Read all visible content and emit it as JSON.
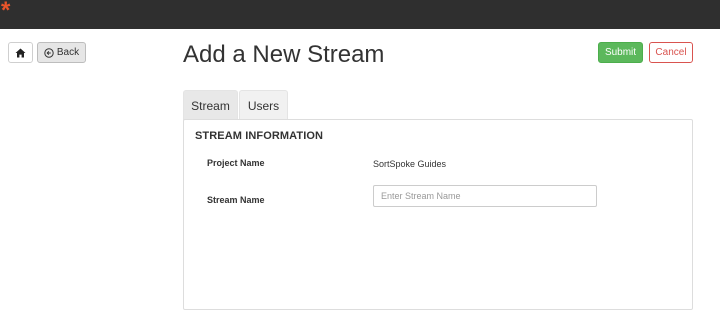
{
  "header": {
    "logo": "*"
  },
  "nav": {
    "back_label": "Back"
  },
  "page": {
    "title": "Add a New Stream"
  },
  "actions": {
    "submit_label": "Submit",
    "cancel_label": "Cancel"
  },
  "tabs": [
    {
      "label": "Stream",
      "active": true
    },
    {
      "label": "Users",
      "active": false
    }
  ],
  "form": {
    "section_title": "STREAM INFORMATION",
    "project_label": "Project Name",
    "project_value": "SortSpoke Guides",
    "stream_label": "Stream Name",
    "stream_value": "",
    "stream_placeholder": "Enter Stream Name"
  },
  "colors": {
    "topbar": "#2f2f2f",
    "brand": "#e8542a",
    "success": "#5cb85c",
    "danger": "#d9534f"
  },
  "icons": {
    "home": "home-icon",
    "back": "circle-arrow-left-icon"
  }
}
